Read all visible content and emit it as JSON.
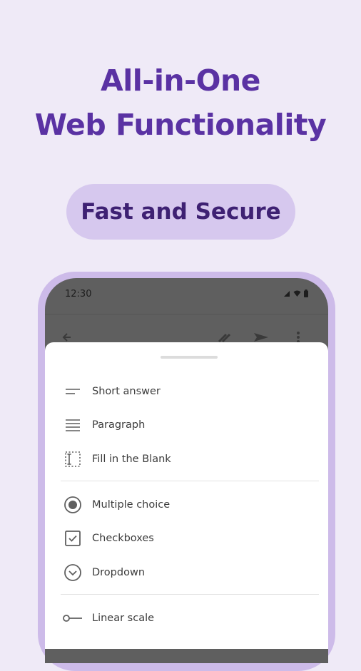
{
  "headline": {
    "line1": "All-in-One",
    "line2": "Web Functionality"
  },
  "badge": {
    "label": "Fast and Secure"
  },
  "phone": {
    "status_time": "12:30",
    "menu_items": [
      {
        "label": "Short answer",
        "icon": "short-answer-icon"
      },
      {
        "label": "Paragraph",
        "icon": "paragraph-icon"
      },
      {
        "label": "Fill in the Blank",
        "icon": "fill-blank-icon"
      },
      {
        "label": "Multiple choice",
        "icon": "radio-button-icon"
      },
      {
        "label": "Checkboxes",
        "icon": "checkbox-icon"
      },
      {
        "label": "Dropdown",
        "icon": "dropdown-icon"
      },
      {
        "label": "Linear scale",
        "icon": "linear-scale-icon"
      }
    ]
  },
  "colors": {
    "background": "#efeaf7",
    "headline": "#5a32a3",
    "badge_bg": "#d6c8ee",
    "badge_text": "#3e2173",
    "phone_frame": "#cdbbe9"
  }
}
